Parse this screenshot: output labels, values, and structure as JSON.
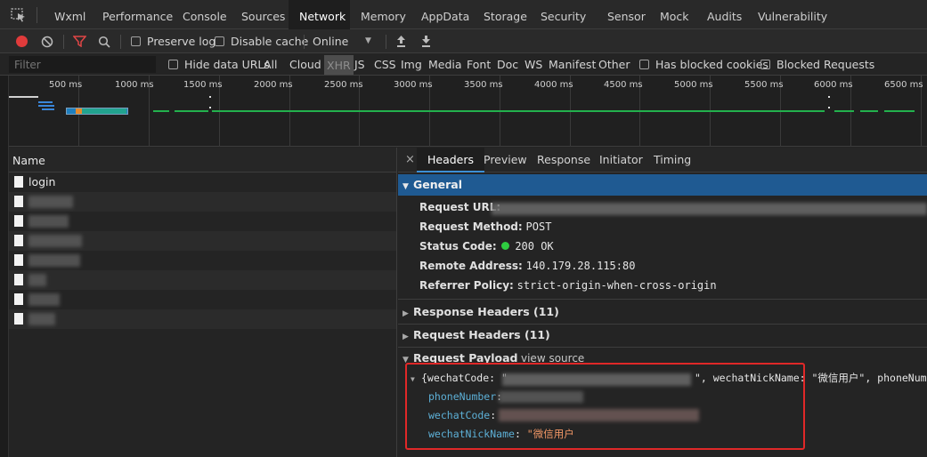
{
  "tabs": [
    "Wxml",
    "Performance",
    "Console",
    "Sources",
    "Network",
    "Memory",
    "AppData",
    "Storage",
    "Security",
    "Sensor",
    "Mock",
    "Audits",
    "Vulnerability"
  ],
  "active_tab": "Network",
  "toolbar": {
    "preserve_log": "Preserve log",
    "disable_cache": "Disable cache",
    "throttle": "Online"
  },
  "filter": {
    "placeholder": "Filter",
    "hide_data_urls": "Hide data URLs",
    "types": [
      "All",
      "Cloud",
      "XHR",
      "JS",
      "CSS",
      "Img",
      "Media",
      "Font",
      "Doc",
      "WS",
      "Manifest",
      "Other"
    ],
    "active_type": "XHR",
    "has_blocked_cookies": "Has blocked cookies",
    "blocked_requests": "Blocked Requests"
  },
  "overview_ticks": [
    "500 ms",
    "1000 ms",
    "1500 ms",
    "2000 ms",
    "2500 ms",
    "3000 ms",
    "3500 ms",
    "4000 ms",
    "4500 ms",
    "5000 ms",
    "5500 ms",
    "6000 ms",
    "6500 ms"
  ],
  "list": {
    "header": "Name",
    "rows": [
      "login",
      "",
      "",
      "",
      "",
      "",
      "",
      ""
    ]
  },
  "detail_tabs": [
    "Headers",
    "Preview",
    "Response",
    "Initiator",
    "Timing"
  ],
  "detail_active": "Headers",
  "general": {
    "title": "General",
    "request_url_label": "Request URL:",
    "request_url_value": "",
    "request_method_label": "Request Method:",
    "request_method_value": "POST",
    "status_code_label": "Status Code:",
    "status_code_value": "200 OK",
    "remote_address_label": "Remote Address:",
    "remote_address_value": "140.179.28.115:80",
    "referrer_policy_label": "Referrer Policy:",
    "referrer_policy_value": "strict-origin-when-cross-origin"
  },
  "response_headers": "Response Headers (11)",
  "request_headers": "Request Headers (11)",
  "payload": {
    "title": "Request Payload",
    "view_source": "view source",
    "summary_prefix": "{wechatCode: \"",
    "summary_mid": "\", wechatNickName: \"微信用户\", phoneNumbe",
    "phone_key": "phoneNumber",
    "code_key": "wechatCode",
    "nick_key": "wechatNickName",
    "nick_value": "\"微信用户"
  },
  "colors": {
    "accent_blue": "#1f5a92",
    "status_green": "#2ecc40",
    "record_red": "#e03b3b",
    "highlight_box": "#e02828",
    "string_orange": "#f29766",
    "key_blue": "#5db0d7"
  }
}
